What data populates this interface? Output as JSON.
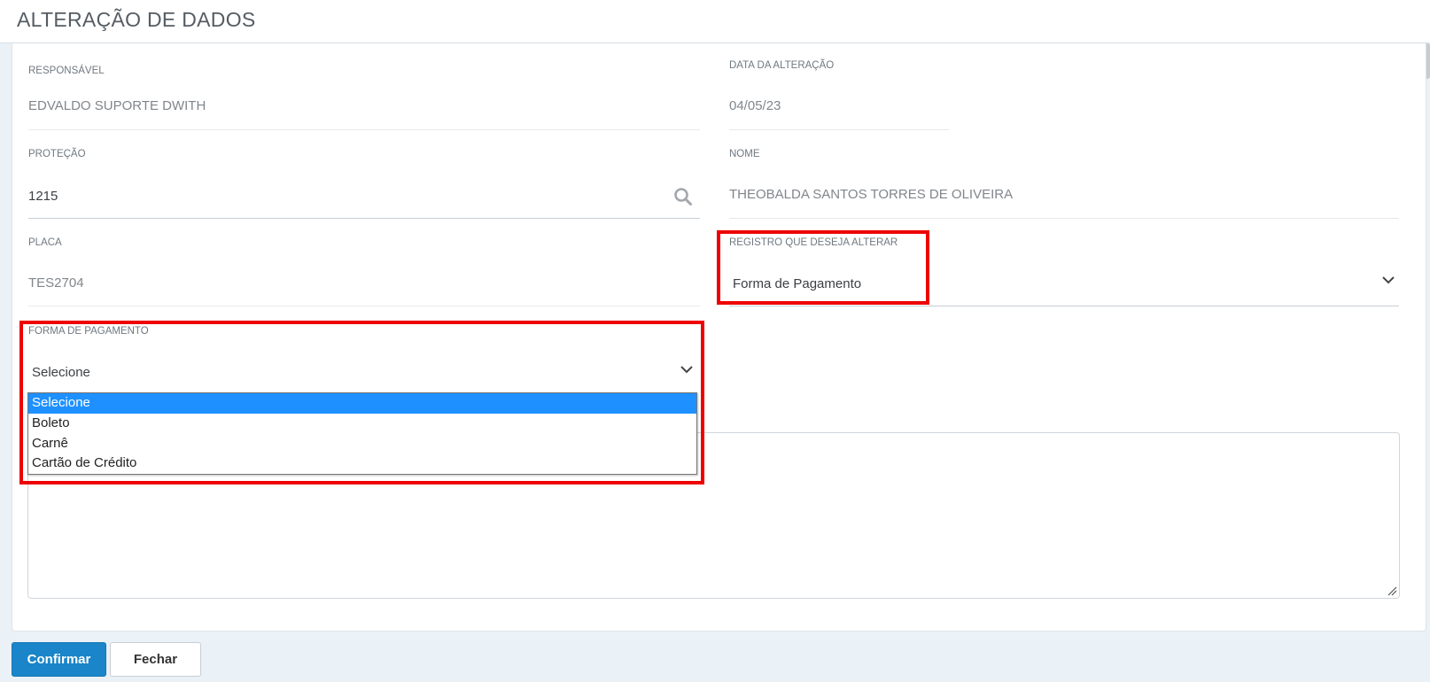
{
  "header": {
    "title": "ALTERAÇÃO DE DADOS"
  },
  "form": {
    "responsavel": {
      "label": "RESPONSÁVEL",
      "value": "EDVALDO SUPORTE DWITH"
    },
    "data_alteracao": {
      "label": "DATA DA ALTERAÇÃO",
      "value": "04/05/23"
    },
    "protecao": {
      "label": "PROTEÇÃO",
      "value": "1215"
    },
    "nome": {
      "label": "NOME",
      "value": "THEOBALDA SANTOS TORRES DE OLIVEIRA"
    },
    "placa": {
      "label": "PLACA",
      "value": "TES2704"
    },
    "registro": {
      "label": "REGISTRO QUE DESEJA ALTERAR",
      "value": "Forma de Pagamento"
    },
    "forma_pagamento": {
      "label": "FORMA DE PAGAMENTO",
      "value": "Selecione",
      "options": [
        "Selecione",
        "Boleto",
        "Carnê",
        "Cartão de Crédito"
      ],
      "selected_index": 0
    }
  },
  "footer": {
    "confirm_label": "Confirmar",
    "close_label": "Fechar"
  },
  "colors": {
    "primary": "#1a85c8",
    "highlight": "#ee0000",
    "option_selected": "#1e90ff"
  }
}
